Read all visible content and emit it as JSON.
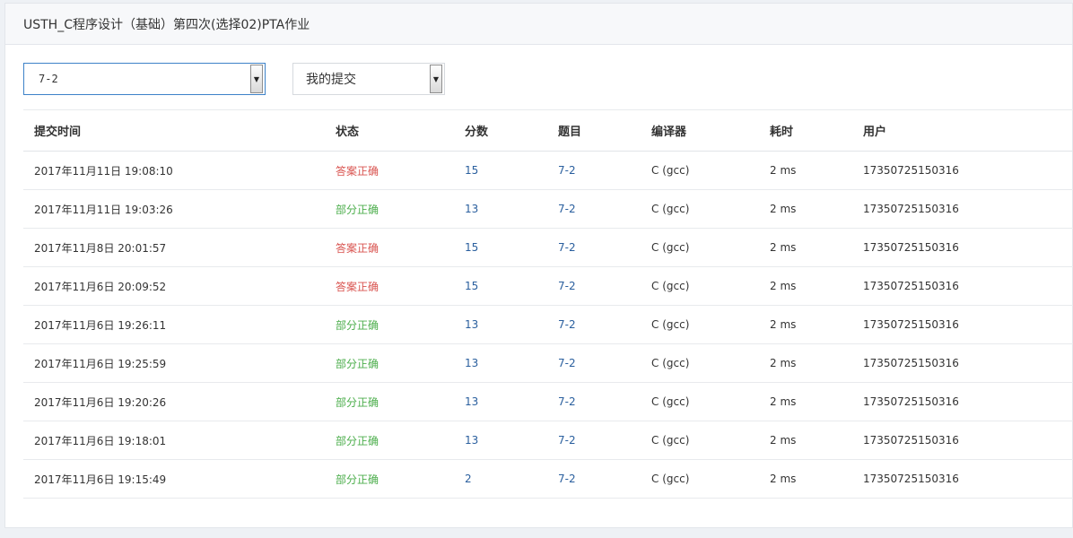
{
  "header": {
    "title": "USTH_C程序设计（基础）第四次(选择02)PTA作业"
  },
  "filters": {
    "problem_value": "7-2",
    "scope_value": "我的提交",
    "arrow_icon": "▼"
  },
  "table": {
    "columns": [
      "提交时间",
      "状态",
      "分数",
      "题目",
      "编译器",
      "耗时",
      "用户"
    ],
    "rows": [
      {
        "time": "2017年11月11日 19:08:10",
        "status": "答案正确",
        "status_kind": "accepted",
        "score": "15",
        "problem": "7-2",
        "compiler": "C (gcc)",
        "cost": "2 ms",
        "user": "17350725150316"
      },
      {
        "time": "2017年11月11日 19:03:26",
        "status": "部分正确",
        "status_kind": "partial",
        "score": "13",
        "problem": "7-2",
        "compiler": "C (gcc)",
        "cost": "2 ms",
        "user": "17350725150316"
      },
      {
        "time": "2017年11月8日 20:01:57",
        "status": "答案正确",
        "status_kind": "accepted",
        "score": "15",
        "problem": "7-2",
        "compiler": "C (gcc)",
        "cost": "2 ms",
        "user": "17350725150316"
      },
      {
        "time": "2017年11月6日 20:09:52",
        "status": "答案正确",
        "status_kind": "accepted",
        "score": "15",
        "problem": "7-2",
        "compiler": "C (gcc)",
        "cost": "2 ms",
        "user": "17350725150316"
      },
      {
        "time": "2017年11月6日 19:26:11",
        "status": "部分正确",
        "status_kind": "partial",
        "score": "13",
        "problem": "7-2",
        "compiler": "C (gcc)",
        "cost": "2 ms",
        "user": "17350725150316"
      },
      {
        "time": "2017年11月6日 19:25:59",
        "status": "部分正确",
        "status_kind": "partial",
        "score": "13",
        "problem": "7-2",
        "compiler": "C (gcc)",
        "cost": "2 ms",
        "user": "17350725150316"
      },
      {
        "time": "2017年11月6日 19:20:26",
        "status": "部分正确",
        "status_kind": "partial",
        "score": "13",
        "problem": "7-2",
        "compiler": "C (gcc)",
        "cost": "2 ms",
        "user": "17350725150316"
      },
      {
        "time": "2017年11月6日 19:18:01",
        "status": "部分正确",
        "status_kind": "partial",
        "score": "13",
        "problem": "7-2",
        "compiler": "C (gcc)",
        "cost": "2 ms",
        "user": "17350725150316"
      },
      {
        "time": "2017年11月6日 19:15:49",
        "status": "部分正确",
        "status_kind": "partial",
        "score": "2",
        "problem": "7-2",
        "compiler": "C (gcc)",
        "cost": "2 ms",
        "user": "17350725150316"
      }
    ]
  },
  "colors": {
    "accepted": "#d9534f",
    "partial": "#4cae4c",
    "link": "#2a5f9e",
    "focus_border": "#3d82c8"
  }
}
